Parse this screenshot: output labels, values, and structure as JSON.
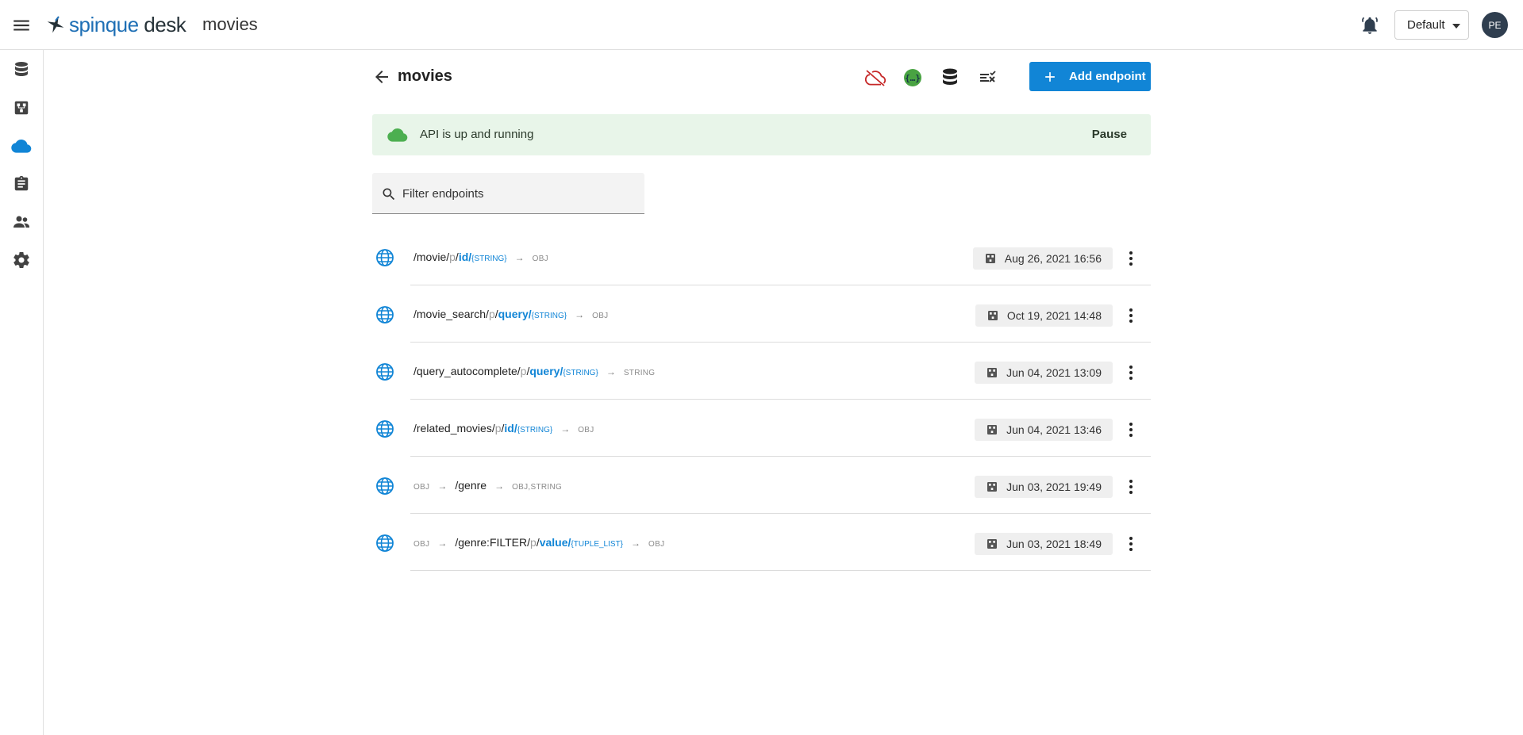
{
  "appbar": {
    "logo_brand": "spinque",
    "logo_rest": " desk",
    "app_title": "movies",
    "workspace": "Default",
    "avatar_initials": "PE"
  },
  "rail": {
    "items": [
      "database-icon",
      "strategy-icon",
      "api-cloud-icon",
      "clipboard-icon",
      "team-icon",
      "settings-icon"
    ],
    "active_color": "#1185d6"
  },
  "header": {
    "title": "movies",
    "add_endpoint_label": "Add endpoint"
  },
  "status": {
    "text": "API is up and running",
    "pause_label": "Pause",
    "color": "#4caf50"
  },
  "filter": {
    "placeholder": "Filter endpoints",
    "value": ""
  },
  "endpoints": [
    {
      "segments": [
        {
          "k": "plain",
          "t": "/movie/"
        },
        {
          "k": "p",
          "t": "p"
        },
        {
          "k": "plain",
          "t": "/"
        },
        {
          "k": "param",
          "t": "id/"
        },
        {
          "k": "type",
          "t": "{STRING}"
        },
        {
          "k": "arrow",
          "t": "→"
        },
        {
          "k": "out",
          "t": "OBJ"
        }
      ],
      "date": "Aug 26, 2021 16:56"
    },
    {
      "segments": [
        {
          "k": "plain",
          "t": "/movie_search/"
        },
        {
          "k": "p",
          "t": "p"
        },
        {
          "k": "plain",
          "t": "/"
        },
        {
          "k": "param",
          "t": "query/"
        },
        {
          "k": "type",
          "t": "{STRING}"
        },
        {
          "k": "arrow",
          "t": "→"
        },
        {
          "k": "out",
          "t": "OBJ"
        }
      ],
      "date": "Oct 19, 2021 14:48"
    },
    {
      "segments": [
        {
          "k": "plain",
          "t": "/query_autocomplete/"
        },
        {
          "k": "p",
          "t": "p"
        },
        {
          "k": "plain",
          "t": "/"
        },
        {
          "k": "param",
          "t": "query/"
        },
        {
          "k": "type",
          "t": "{STRING}"
        },
        {
          "k": "arrow",
          "t": "→"
        },
        {
          "k": "out",
          "t": "STRING"
        }
      ],
      "date": "Jun 04, 2021 13:09"
    },
    {
      "segments": [
        {
          "k": "plain",
          "t": "/related_movies/"
        },
        {
          "k": "p",
          "t": "p"
        },
        {
          "k": "plain",
          "t": "/"
        },
        {
          "k": "param",
          "t": "id/"
        },
        {
          "k": "type",
          "t": "{STRING}"
        },
        {
          "k": "arrow",
          "t": "→"
        },
        {
          "k": "out",
          "t": "OBJ"
        }
      ],
      "date": "Jun 04, 2021 13:46"
    },
    {
      "segments": [
        {
          "k": "out",
          "t": "OBJ"
        },
        {
          "k": "arrow",
          "t": "→"
        },
        {
          "k": "plain",
          "t": "/genre"
        },
        {
          "k": "arrow",
          "t": "→"
        },
        {
          "k": "out",
          "t": "OBJ,STRING"
        }
      ],
      "date": "Jun 03, 2021 19:49"
    },
    {
      "segments": [
        {
          "k": "out",
          "t": "OBJ"
        },
        {
          "k": "arrow",
          "t": "→"
        },
        {
          "k": "plain",
          "t": "/genre:FILTER/"
        },
        {
          "k": "p",
          "t": "p"
        },
        {
          "k": "plain",
          "t": "/"
        },
        {
          "k": "param",
          "t": "value/"
        },
        {
          "k": "type",
          "t": "{TUPLE_LIST}"
        },
        {
          "k": "arrow",
          "t": "→"
        },
        {
          "k": "out",
          "t": "OBJ"
        }
      ],
      "date": "Jun 03, 2021 18:49"
    }
  ]
}
